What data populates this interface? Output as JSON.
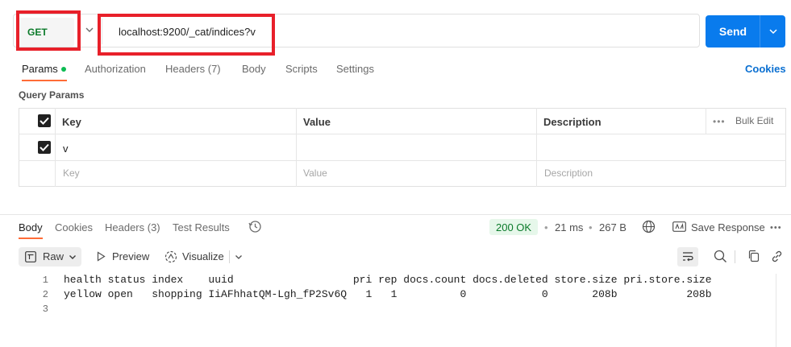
{
  "request": {
    "method": "GET",
    "url": "localhost:9200/_cat/indices?v",
    "send_label": "Send"
  },
  "request_tabs": [
    {
      "label": "Params",
      "active": true
    },
    {
      "label": "Authorization",
      "active": false
    },
    {
      "label": "Headers (7)",
      "active": false
    },
    {
      "label": "Body",
      "active": false
    },
    {
      "label": "Scripts",
      "active": false
    },
    {
      "label": "Settings",
      "active": false
    }
  ],
  "cookies_link": "Cookies",
  "query_params": {
    "title": "Query Params",
    "headers": {
      "key": "Key",
      "value": "Value",
      "description": "Description",
      "bulk_edit": "Bulk Edit"
    },
    "rows": [
      {
        "checked": true,
        "key": "v",
        "value": "",
        "description": ""
      }
    ],
    "placeholders": {
      "key": "Key",
      "value": "Value",
      "description": "Description"
    }
  },
  "response_tabs": [
    {
      "label": "Body",
      "active": true
    },
    {
      "label": "Cookies",
      "active": false
    },
    {
      "label": "Headers (3)",
      "active": false
    },
    {
      "label": "Test Results",
      "active": false
    }
  ],
  "response_meta": {
    "status": "200 OK",
    "time": "21 ms",
    "size": "267 B",
    "save_response": "Save Response"
  },
  "view_toolbar": {
    "format": "Raw",
    "preview": "Preview",
    "visualize": "Visualize"
  },
  "response_body": {
    "lines": [
      {
        "num": "1",
        "text": "health status index    uuid                   pri rep docs.count docs.deleted store.size pri.store.size"
      },
      {
        "num": "2",
        "text": "yellow open   shopping IiAFhhatQM-Lgh_fP2Sv6Q   1   1          0            0       208b           208b"
      },
      {
        "num": "3",
        "text": ""
      }
    ]
  },
  "colors": {
    "accent": "#097bed",
    "method_get": "#0b7a2a",
    "tab_underline": "#ff6c37",
    "highlight_box": "#e8202a",
    "status_ok_bg": "#e6f7ea"
  }
}
